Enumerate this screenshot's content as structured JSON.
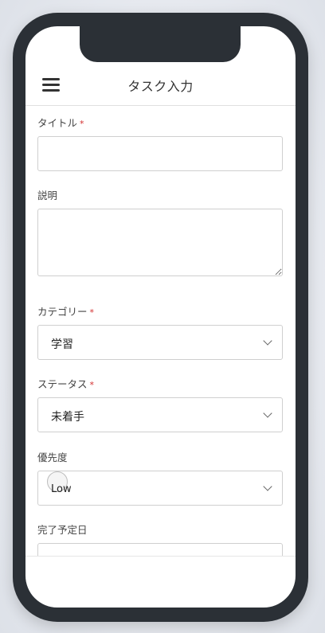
{
  "appbar": {
    "title": "タスク入力",
    "menu_icon": "hamburger-menu-icon"
  },
  "form": {
    "title_field": {
      "label": "タイトル",
      "required_mark": "*",
      "value": ""
    },
    "description_field": {
      "label": "説明",
      "value": ""
    },
    "category_field": {
      "label": "カテゴリー",
      "required_mark": "*",
      "value": "学習"
    },
    "status_field": {
      "label": "ステータス",
      "required_mark": "*",
      "value": "未着手"
    },
    "priority_field": {
      "label": "優先度",
      "value": "Low"
    },
    "due_date_field": {
      "label": "完了予定日"
    }
  },
  "colors": {
    "frame": "#2b3036",
    "required": "#d32f2f",
    "border": "#cfcfcf"
  }
}
